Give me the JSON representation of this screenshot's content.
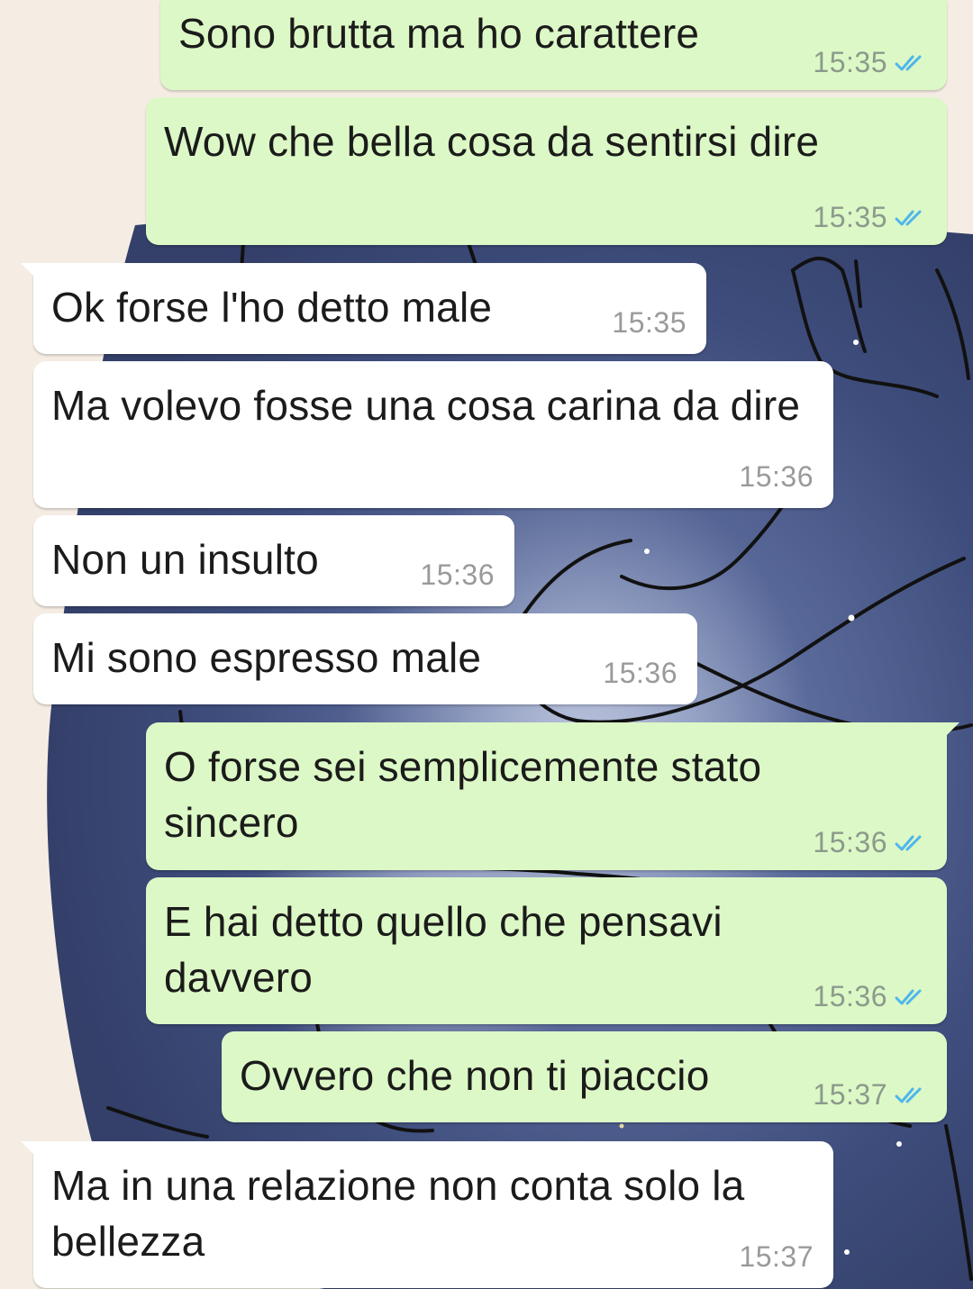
{
  "messages": [
    {
      "text": "Sono brutta ma ho carattere",
      "time": "15:35",
      "direction": "out",
      "status": "read"
    },
    {
      "text": "Wow che bella cosa da sentirsi dire",
      "time": "15:35",
      "direction": "out",
      "status": "read"
    },
    {
      "text": "Ok forse l'ho detto male",
      "time": "15:35",
      "direction": "in"
    },
    {
      "text": "Ma volevo fosse una cosa carina da dire",
      "time": "15:36",
      "direction": "in"
    },
    {
      "text": "Non un insulto",
      "time": "15:36",
      "direction": "in"
    },
    {
      "text": "Mi sono espresso male",
      "time": "15:36",
      "direction": "in"
    },
    {
      "text": "O forse sei semplicemente stato sincero",
      "time": "15:36",
      "direction": "out",
      "status": "read"
    },
    {
      "text": "E hai detto quello che pensavi davvero",
      "time": "15:36",
      "direction": "out",
      "status": "read"
    },
    {
      "text": "Ovvero che non ti piaccio",
      "time": "15:37",
      "direction": "out",
      "status": "read"
    },
    {
      "text": "Ma in una relazione non conta solo la bellezza",
      "time": "15:37",
      "direction": "in"
    }
  ],
  "colors": {
    "outgoing_bubble": "#dcf8c6",
    "incoming_bubble": "#ffffff",
    "read_ticks": "#4fb6ec",
    "wallpaper_dark": "#3c4c78",
    "wallpaper_light": "#f5ede3"
  },
  "icons": {
    "read_receipt": "double-check-icon"
  }
}
